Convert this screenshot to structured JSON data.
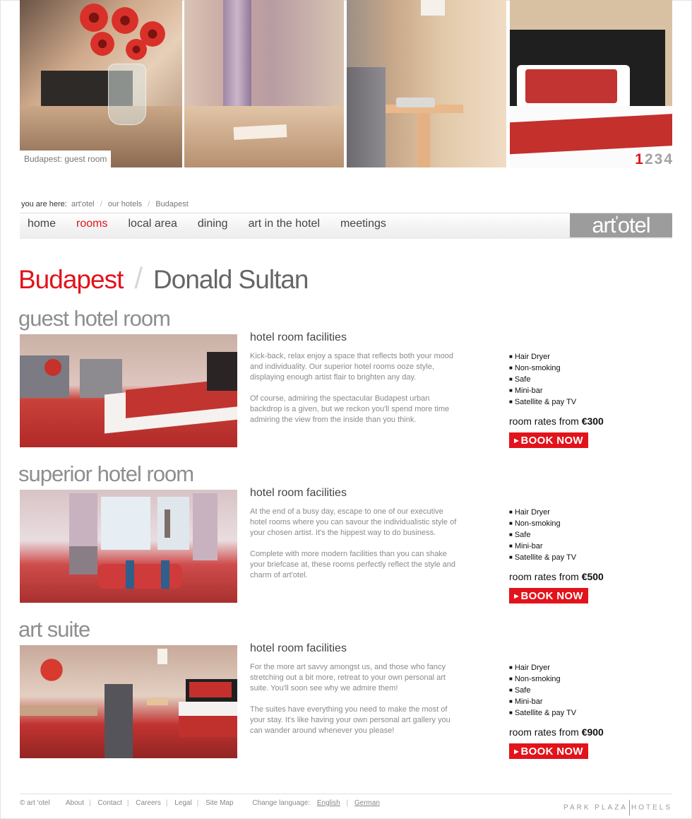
{
  "hero": {
    "caption": "Budapest: guest room",
    "pages": [
      "1",
      "2",
      "3",
      "4"
    ],
    "active_page": "1"
  },
  "breadcrumb": {
    "label": "you are here:",
    "items": [
      "art'otel",
      "our hotels",
      "Budapest"
    ],
    "separator": "/"
  },
  "nav": {
    "items": [
      "home",
      "rooms",
      "local area",
      "dining",
      "art in the hotel",
      "meetings"
    ],
    "active": "rooms"
  },
  "logo": {
    "text_left": "art",
    "text_mark": "'",
    "text_right": "otel"
  },
  "title": {
    "city": "Budapest",
    "slash": "/",
    "artist": "Donald Sultan"
  },
  "rooms": [
    {
      "name": "guest hotel room",
      "facilities_heading": "hotel room facilities",
      "paragraphs": [
        "Kick-back, relax enjoy a space that reflects both your mood and individuality. Our superior hotel rooms ooze style, displaying enough artist flair to brighten any day.",
        "Of course, admiring the spectacular Budapest urban backdrop is a given, but we reckon you'll spend more time admiring the view from the inside than you think."
      ],
      "facilities": [
        "Hair Dryer",
        "Non-smoking",
        "Safe",
        "Mini-bar",
        "Satellite & pay TV"
      ],
      "rate_label": "room rates from ",
      "rate_price": "€300",
      "book_label": "BOOK NOW"
    },
    {
      "name": "superior hotel room",
      "facilities_heading": "hotel room facilities",
      "paragraphs": [
        "At the end of a busy day, escape to one of our executive hotel rooms where you can savour the individualistic style of your chosen artist. It's the hippest way to do business.",
        "Complete with more modern facilities than you can shake your briefcase at, these rooms perfectly reflect the style and charm of art'otel."
      ],
      "facilities": [
        "Hair Dryer",
        "Non-smoking",
        "Safe",
        "Mini-bar",
        "Satellite & pay TV"
      ],
      "rate_label": "room rates from ",
      "rate_price": "€500",
      "book_label": "BOOK NOW"
    },
    {
      "name": "art suite",
      "facilities_heading": "hotel room facilities",
      "paragraphs": [
        "For the more art savvy amongst us, and those who fancy stretching out a bit more, retreat to your own personal art suite. You'll soon see why we admire them!",
        "The suites have everything you need to make the most of your stay. It's like having your own personal art gallery you can wander around whenever you please!"
      ],
      "facilities": [
        "Hair Dryer",
        "Non-smoking",
        "Safe",
        "Mini-bar",
        "Satellite & pay TV"
      ],
      "rate_label": "room rates from ",
      "rate_price": "€900",
      "book_label": "BOOK NOW"
    }
  ],
  "footer": {
    "copyright": "© art 'otel",
    "links": [
      "About",
      "Contact",
      "Careers",
      "Legal",
      "Site Map"
    ],
    "language_label": "Change language:",
    "languages": [
      "English",
      "German"
    ],
    "brand_left": "PARK PLAZA",
    "brand_right": "HOTELS"
  },
  "colors": {
    "accent": "#e2131b",
    "text_gray": "#8a8a8a",
    "logo_bg": "#9c9c9c"
  }
}
